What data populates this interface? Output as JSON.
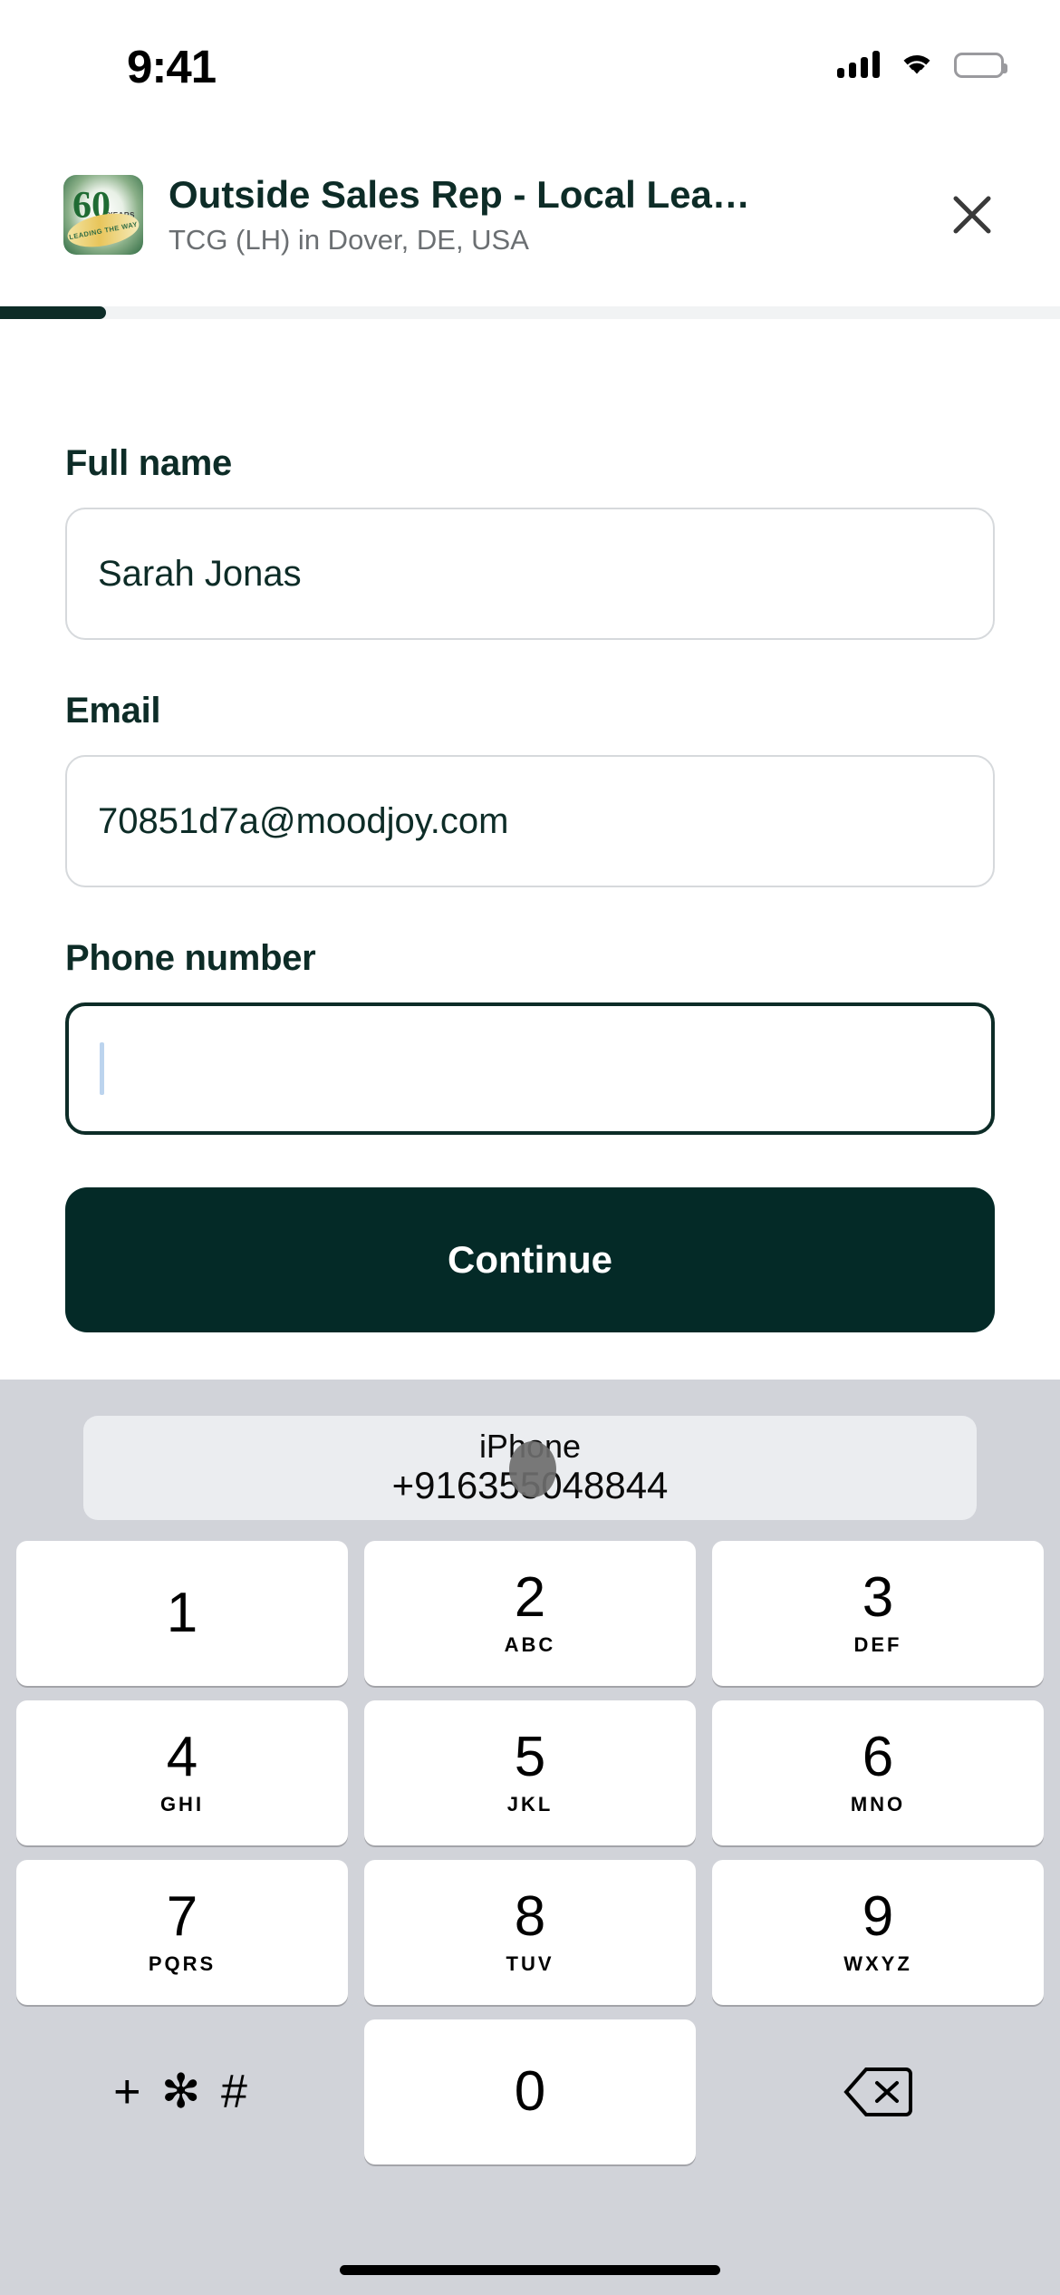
{
  "status_bar": {
    "time": "9:41",
    "cellular_icon": "signal-bars-icon",
    "wifi_icon": "wifi-icon",
    "battery_icon": "battery-full-icon"
  },
  "job_header": {
    "logo_alt": "company-logo-60-years",
    "logo_number": "60",
    "logo_years": "YEARS",
    "logo_ribbon": "LEADING THE WAY",
    "title": "Outside Sales Rep - Local Lea…",
    "subtitle": "TCG (LH) in Dover, DE, USA",
    "close_label": "✕"
  },
  "progress": {
    "percent": 10,
    "fill_color": "#0d2c27",
    "track_color": "#f1f3f4"
  },
  "form": {
    "fields": [
      {
        "label": "Full name",
        "value": "Sarah Jonas",
        "placeholder": "Full name",
        "focused": false
      },
      {
        "label": "Email",
        "value": "70851d7a@moodjoy.com",
        "placeholder": "Email",
        "focused": false
      },
      {
        "label": "Phone number",
        "value": "",
        "placeholder": "",
        "focused": true
      }
    ],
    "submit_label": "Continue"
  },
  "keyboard": {
    "type": "numeric-phone-pad",
    "background_color": "#d1d3d9",
    "autofill": {
      "title": "iPhone",
      "number": "+916355048844"
    },
    "rows": [
      [
        {
          "num": "1",
          "sub": ""
        },
        {
          "num": "2",
          "sub": "ABC"
        },
        {
          "num": "3",
          "sub": "DEF"
        }
      ],
      [
        {
          "num": "4",
          "sub": "GHI"
        },
        {
          "num": "5",
          "sub": "JKL"
        },
        {
          "num": "6",
          "sub": "MNO"
        }
      ],
      [
        {
          "num": "7",
          "sub": "PQRS"
        },
        {
          "num": "8",
          "sub": "TUV"
        },
        {
          "num": "9",
          "sub": "WXYZ"
        }
      ],
      [
        {
          "num": "+ ✻ #",
          "sub": "",
          "plain": true
        },
        {
          "num": "0",
          "sub": ""
        },
        {
          "num": "",
          "sub": "",
          "plain": true,
          "icon": "backspace-icon"
        }
      ]
    ]
  },
  "home_indicator": "home-indicator-bar",
  "colors": {
    "accent": "#042A27",
    "label": "#0d2c27",
    "muted": "#6b6f72",
    "border": "#d6d9dc",
    "caret": "#bcd4ee"
  }
}
